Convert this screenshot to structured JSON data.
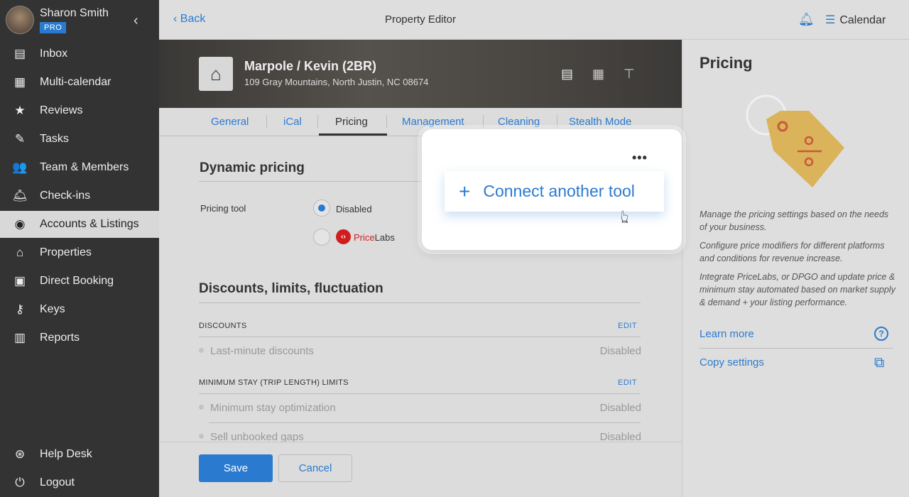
{
  "user": {
    "name": "Sharon Smith",
    "badge": "PRO"
  },
  "sidebar": {
    "items": [
      {
        "label": "Inbox",
        "icon": "inbox-icon",
        "glyph": "▤"
      },
      {
        "label": "Multi-calendar",
        "icon": "calendar-icon",
        "glyph": "▦"
      },
      {
        "label": "Reviews",
        "icon": "star-icon",
        "glyph": "★"
      },
      {
        "label": "Tasks",
        "icon": "tasks-icon",
        "glyph": "✎"
      },
      {
        "label": "Team & Members",
        "icon": "team-icon",
        "glyph": "👥"
      },
      {
        "label": "Check-ins",
        "icon": "bell-service-icon",
        "glyph": "🛎"
      },
      {
        "label": "Accounts & Listings",
        "icon": "account-icon",
        "glyph": "◉"
      },
      {
        "label": "Properties",
        "icon": "home-icon",
        "glyph": "⌂"
      },
      {
        "label": "Direct Booking",
        "icon": "code-icon",
        "glyph": "▣"
      },
      {
        "label": "Keys",
        "icon": "key-icon",
        "glyph": "⚷"
      },
      {
        "label": "Reports",
        "icon": "reports-icon",
        "glyph": "▥"
      }
    ],
    "bottom": [
      {
        "label": "Help Desk",
        "icon": "lifebuoy-icon",
        "glyph": "⊛"
      },
      {
        "label": "Logout",
        "icon": "power-icon",
        "glyph": "⏻"
      }
    ],
    "active": "Accounts & Listings"
  },
  "topbar": {
    "back": "Back",
    "title": "Property Editor",
    "calendar": "Calendar"
  },
  "listing": {
    "name": "Marpole / Kevin (2BR)",
    "address": "109 Gray Mountains, North Justin, NC 08674"
  },
  "tabs": [
    "General",
    "iCal",
    "Pricing",
    "Management",
    "Cleaning",
    "Stealth Mode"
  ],
  "active_tab": "Pricing",
  "dynamic": {
    "title": "Dynamic pricing",
    "label": "Pricing tool",
    "options": [
      {
        "label": "Disabled",
        "selected": true
      },
      {
        "label_a": "Price",
        "label_b": "Labs",
        "selected": false
      }
    ]
  },
  "discounts": {
    "title": "Discounts, limits, fluctuation",
    "sections": [
      {
        "header": "DISCOUNTS",
        "edit": "EDIT",
        "rows": [
          {
            "label": "Last-minute discounts",
            "value": "Disabled"
          }
        ]
      },
      {
        "header": "MINIMUM STAY (TRIP LENGTH) LIMITS",
        "edit": "EDIT",
        "rows": [
          {
            "label": "Minimum stay optimization",
            "value": "Disabled"
          },
          {
            "label": "Sell unbooked gaps",
            "value": "Disabled"
          }
        ]
      }
    ]
  },
  "footer": {
    "save": "Save",
    "cancel": "Cancel"
  },
  "popup": {
    "more": "•••",
    "connect": "Connect another tool"
  },
  "right": {
    "title": "Pricing",
    "p1": "Manage the pricing settings based on the needs of your business.",
    "p2": "Configure price modifiers for different platforms and conditions for revenue increase.",
    "p3": "Integrate PriceLabs, or DPGO and update price & minimum stay automated based on market supply & demand + your listing performance.",
    "learn": "Learn more",
    "copy": "Copy settings"
  },
  "colors": {
    "accent": "#2a7bd0",
    "sidebar": "#333333",
    "pricelabs": "#d01e1e"
  }
}
